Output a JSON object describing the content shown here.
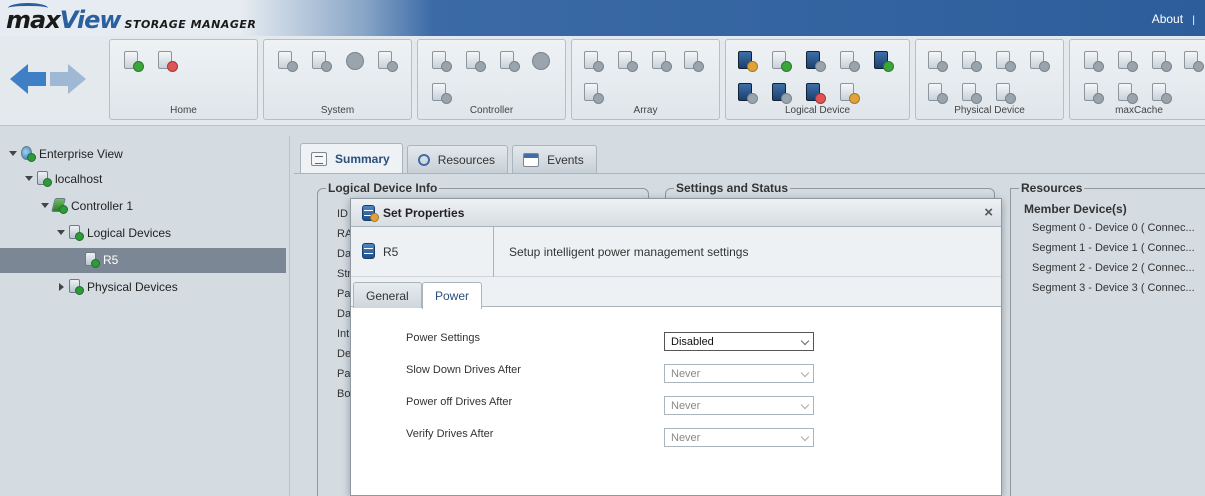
{
  "header": {
    "logo_max": "max",
    "logo_view": "View",
    "logo_sub": "STORAGE MANAGER",
    "about": "About",
    "about_sep": "|"
  },
  "toolbar": {
    "groups": [
      {
        "label": "Home"
      },
      {
        "label": "System"
      },
      {
        "label": "Controller"
      },
      {
        "label": "Array"
      },
      {
        "label": "Logical Device"
      },
      {
        "label": "Physical Device"
      },
      {
        "label": "maxCache"
      }
    ]
  },
  "tree": {
    "enterprise": "Enterprise View",
    "host": "localhost",
    "controller": "Controller 1",
    "logical": "Logical Devices",
    "device": "R5",
    "physical": "Physical Devices"
  },
  "tabs": {
    "summary": "Summary",
    "resources": "Resources",
    "events": "Events"
  },
  "panels": {
    "logical_info": "Logical Device Info",
    "settings": "Settings and Status",
    "resources": "Resources",
    "labels": [
      "ID",
      "RA",
      "Da",
      "Str",
      "Pa",
      "Da",
      "Int",
      "De",
      "Pa",
      "Bo"
    ],
    "member_title": "Member Device(s)",
    "members": [
      "Segment 0 - Device 0 ( Connec...",
      "Segment 1 - Device 1 ( Connec...",
      "Segment 2 - Device 2 ( Connec...",
      "Segment 3 - Device 3 ( Connec..."
    ]
  },
  "modal": {
    "title": "Set Properties",
    "close": "×",
    "device": "R5",
    "description": "Setup intelligent power management settings",
    "tab_general": "General",
    "tab_power": "Power",
    "fields": [
      {
        "label": "Power Settings",
        "value": "Disabled"
      },
      {
        "label": "Slow Down Drives After",
        "value": "Never"
      },
      {
        "label": "Power off Drives After",
        "value": "Never"
      },
      {
        "label": "Verify Drives After",
        "value": "Never"
      }
    ]
  }
}
